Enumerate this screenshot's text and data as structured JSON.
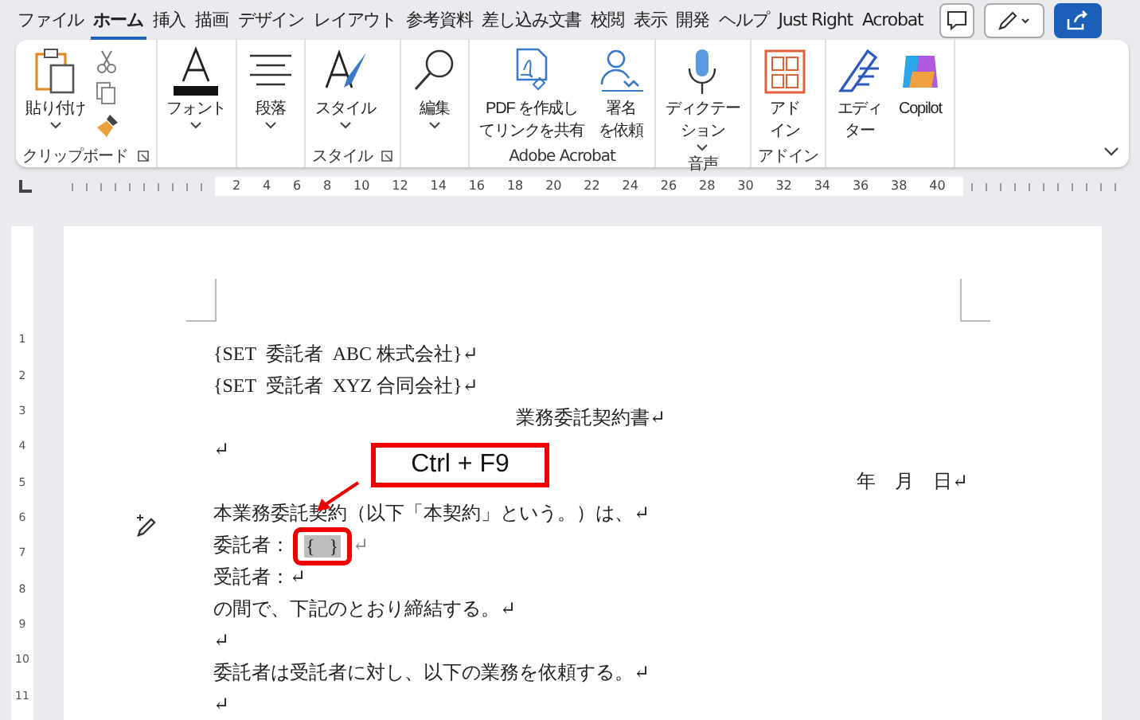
{
  "menu_tabs": [
    {
      "label": "ファイル",
      "selected": false
    },
    {
      "label": "ホーム",
      "selected": true
    },
    {
      "label": "挿入",
      "selected": false
    },
    {
      "label": "描画",
      "selected": false
    },
    {
      "label": "デザイン",
      "selected": false
    },
    {
      "label": "レイアウト",
      "selected": false
    },
    {
      "label": "参考資料",
      "selected": false
    },
    {
      "label": "差し込み文書",
      "selected": false
    },
    {
      "label": "校閲",
      "selected": false
    },
    {
      "label": "表示",
      "selected": false
    },
    {
      "label": "開発",
      "selected": false
    },
    {
      "label": "ヘルプ",
      "selected": false
    },
    {
      "label": "Just Right",
      "selected": false
    },
    {
      "label": "Acrobat",
      "selected": false
    }
  ],
  "ribbon_groups": [
    {
      "label": "クリップボード",
      "launcher": true,
      "items": [
        {
          "kind": "paste",
          "label_lines": [
            "貼り付け"
          ],
          "caret": true
        },
        {
          "kind": "clip_small"
        }
      ]
    },
    {
      "items": [
        {
          "kind": "font",
          "label_lines": [
            "フォント"
          ],
          "caret": true
        }
      ]
    },
    {
      "items": [
        {
          "kind": "paragraph",
          "label_lines": [
            "段落"
          ],
          "caret": true
        }
      ]
    },
    {
      "label": "スタイル",
      "launcher": true,
      "items": [
        {
          "kind": "style",
          "label_lines": [
            "スタイル"
          ],
          "caret": true
        }
      ]
    },
    {
      "items": [
        {
          "kind": "search",
          "label_lines": [
            "編集"
          ],
          "caret": true
        }
      ]
    },
    {
      "label": "Adobe Acrobat",
      "items": [
        {
          "kind": "pdf",
          "label_lines": [
            "PDF を作成し",
            "てリンクを共有"
          ]
        },
        {
          "kind": "sign",
          "label_lines": [
            "署名",
            "を依頼"
          ]
        }
      ]
    },
    {
      "label": "音声",
      "items": [
        {
          "kind": "mic",
          "label_lines": [
            "ディクテー",
            "ション"
          ],
          "caret": true
        }
      ]
    },
    {
      "label": "アドイン",
      "items": [
        {
          "kind": "addin",
          "label_lines": [
            "アド",
            "イン"
          ]
        }
      ]
    },
    {
      "items": [
        {
          "kind": "editor",
          "label_lines": [
            "エディ",
            "ター"
          ]
        },
        {
          "kind": "copilot",
          "label_lines": [
            "Copilot"
          ]
        }
      ]
    }
  ],
  "ruler": {
    "labels": [
      "2",
      "4",
      "6",
      "8",
      "10",
      "12",
      "14",
      "16",
      "18",
      "20",
      "22",
      "24",
      "26",
      "28",
      "30",
      "32",
      "34",
      "36",
      "38",
      "40"
    ]
  },
  "vertical_ruler": {
    "labels": [
      "1",
      "2",
      "3",
      "4",
      "5",
      "6",
      "7",
      "8",
      "9",
      "10",
      "11"
    ]
  },
  "document_lines": [
    {
      "kind": "text",
      "text": "{SET  委託者  ABC 株式会社}↵"
    },
    {
      "kind": "text",
      "text": "{SET  受託者  XYZ 合同会社}↵"
    },
    {
      "kind": "heading",
      "text": "業務委託契約書↵"
    },
    {
      "kind": "text",
      "text": "↵"
    },
    {
      "kind": "date",
      "text": "年　月　日↵"
    },
    {
      "kind": "text",
      "text": "本業務委託契約（以下「本契約」という。）は、↵"
    },
    {
      "kind": "field",
      "text": "委託者：",
      "field": "{   }",
      "mark": "↵"
    },
    {
      "kind": "text",
      "text": "受託者：↵"
    },
    {
      "kind": "text",
      "text": "の間で、下記のとおり締結する。↵"
    },
    {
      "kind": "text",
      "text": "↵"
    },
    {
      "kind": "text",
      "text": "委託者は受託者に対し、以下の業務を依頼する。↵"
    },
    {
      "kind": "text",
      "text": "↵"
    }
  ],
  "callout": {
    "text": "Ctrl + F9"
  }
}
